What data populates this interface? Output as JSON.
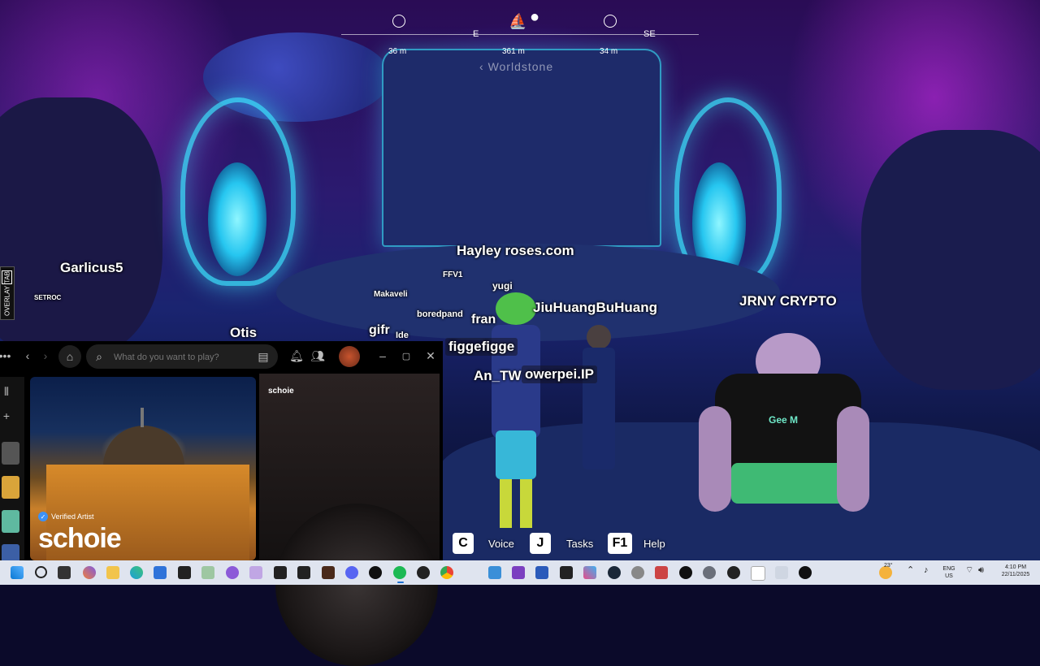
{
  "compass": {
    "directions": [
      "E",
      "SE"
    ],
    "distances": [
      "36 m",
      "361 m",
      "34 m"
    ],
    "destination": "Worldstone"
  },
  "players": {
    "garlicus": "Garlicus5",
    "setroc": "SETROC",
    "otis": "Otis",
    "hayley": "Hayley roses.com",
    "ffv1": "FFV1",
    "yugi": "yugi",
    "makaveli": "Makaveli",
    "boredpand": "boredpand",
    "fran": "fran",
    "jiuhuang": "JiuHuangBuHuang",
    "jrny": "JRNY CRYPTO",
    "gifr": "gifr",
    "ide": "Ide",
    "figgefigge": "figgefigge",
    "an_tw": "An_TW",
    "owerpei": "owerpei.IP"
  },
  "overlay_tab": {
    "label": "OVERLAY",
    "key": "TAB"
  },
  "controls": [
    {
      "key": "C",
      "label": "Voice"
    },
    {
      "key": "J",
      "label": "Tasks"
    },
    {
      "key": "F1",
      "label": "Help"
    }
  ],
  "spotify": {
    "search_placeholder": "What do you want to play?",
    "verified_label": "Verified Artist",
    "artist_name": "schoie",
    "panel_title": "schoie",
    "window_controls": [
      "–",
      "▢",
      "✕"
    ]
  },
  "character_shirt_text": "Gee M",
  "taskbar": {
    "weather": "23°",
    "language": "ENG",
    "region": "US",
    "time": "4:10 PM",
    "date": "22/11/2025"
  },
  "colors": {
    "accent_cyan": "#3ce6ff",
    "spotify_green": "#1db954",
    "verified_blue": "#3d91f4",
    "taskbar_bg": "#dfe4ef"
  }
}
